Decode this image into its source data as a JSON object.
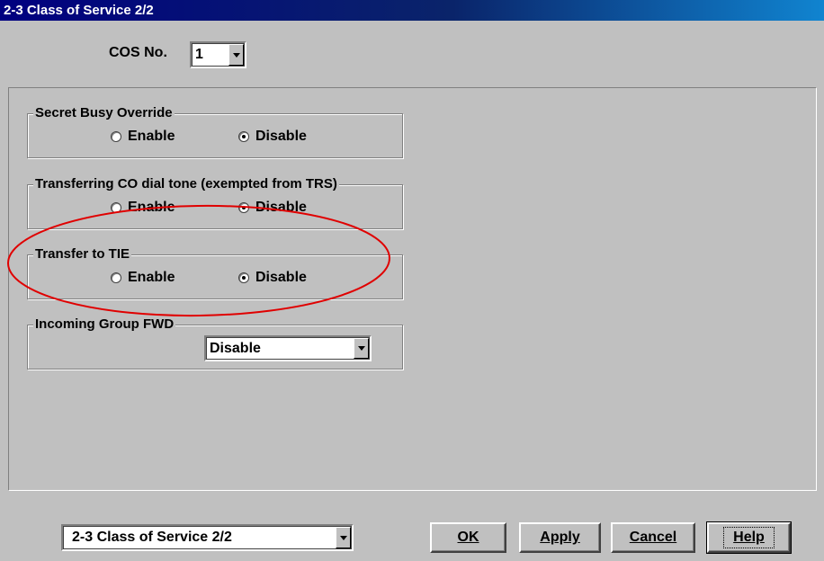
{
  "window": {
    "title": "2-3 Class of Service 2/2"
  },
  "cos": {
    "label": "COS No.",
    "value": "1"
  },
  "groups": {
    "secret_busy_override": {
      "title": "Secret Busy Override",
      "enable": "Enable",
      "disable": "Disable",
      "selected": "Disable"
    },
    "transferring_co": {
      "title": "Transferring CO dial tone (exempted from TRS)",
      "enable": "Enable",
      "disable": "Disable",
      "selected": "Disable"
    },
    "transfer_to_tie": {
      "title": "Transfer to TIE",
      "enable": "Enable",
      "disable": "Disable",
      "selected": "Disable"
    },
    "incoming_group_fwd": {
      "title": "Incoming Group FWD",
      "value": "Disable"
    }
  },
  "footer": {
    "page_select": "2-3 Class of Service 2/2",
    "ok": "OK",
    "apply": "Apply",
    "cancel": "Cancel",
    "help": "Help"
  },
  "colors": {
    "title_bar": "#000080",
    "annotation_ellipse": "#e00000",
    "face": "#c0c0c0"
  }
}
